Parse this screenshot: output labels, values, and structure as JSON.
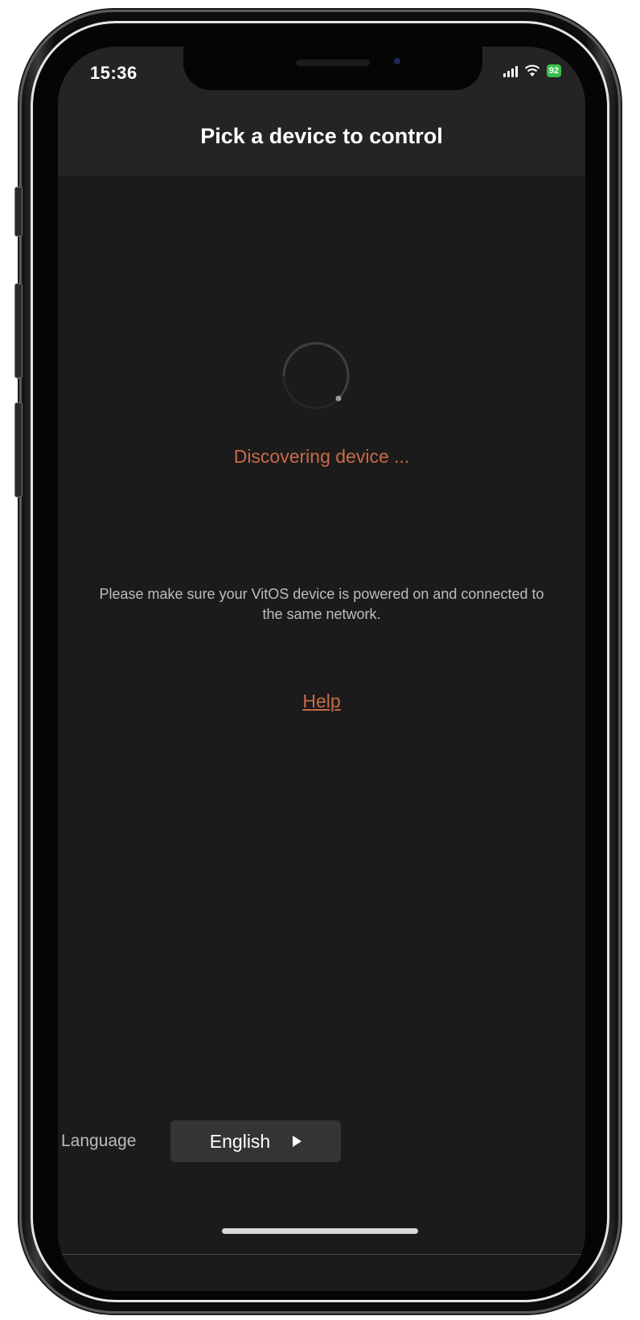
{
  "status_bar": {
    "time": "15:36",
    "battery": "92",
    "icons": [
      "signal-icon",
      "wifi-icon",
      "battery-icon"
    ]
  },
  "header": {
    "title": "Pick a device to control"
  },
  "discovery": {
    "status": "Discovering device ...",
    "info": "Please make sure your VitOS device is powered on and connected to the same network.",
    "help_label": "Help",
    "spinner_icon": "loading-spinner-icon"
  },
  "footer": {
    "language_label": "Language",
    "language_value": "English",
    "arrow_icon": "triangle-right-icon"
  },
  "colors": {
    "background": "#1b1b1b",
    "header_background": "#242424",
    "accent": "#c86a49",
    "text_muted": "#bdbdbd",
    "battery_green": "#37c24a"
  }
}
